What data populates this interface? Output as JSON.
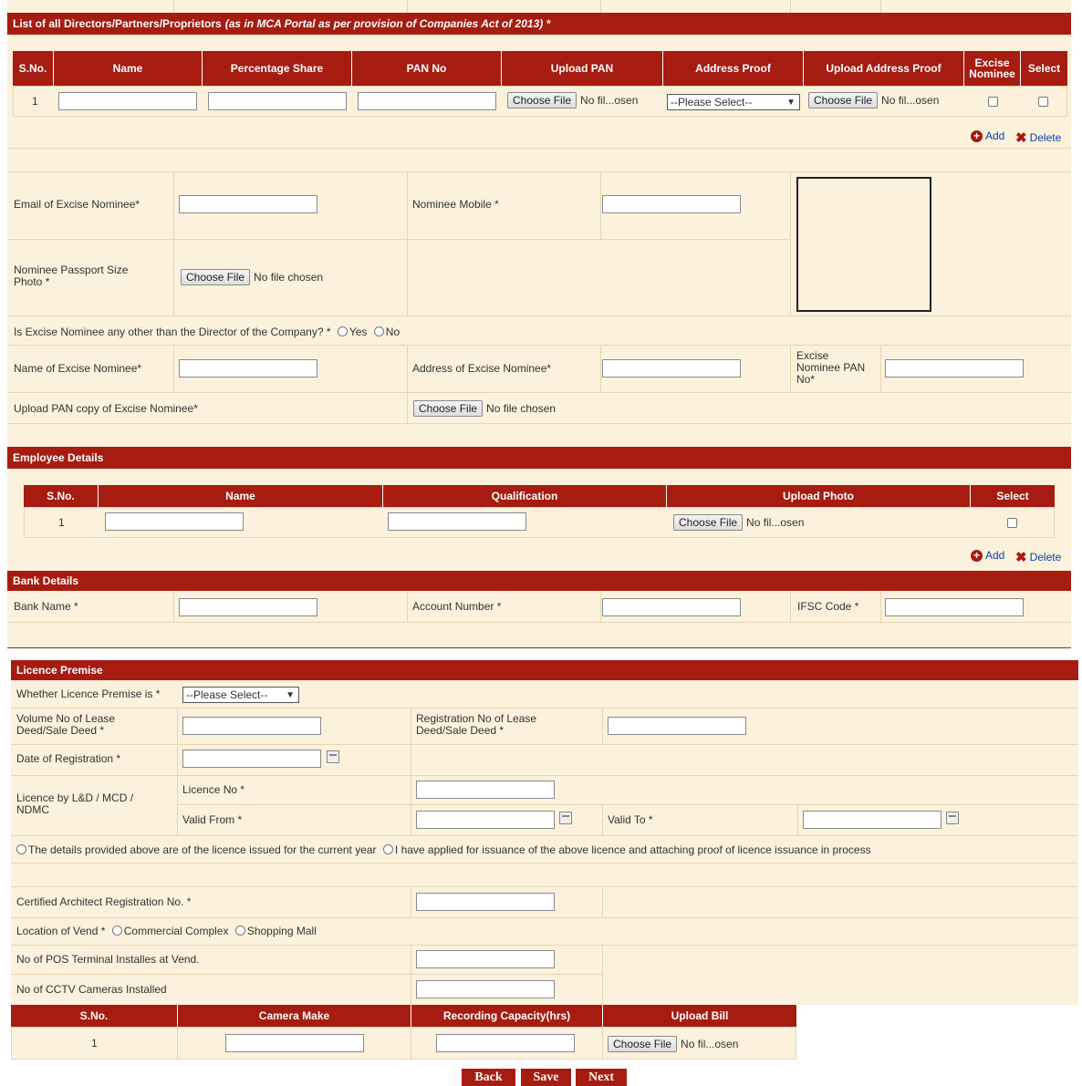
{
  "directors": {
    "title": "List of all Directors/Partners/Proprietors",
    "title_note": "(as in MCA Portal as per provision of Companies Act of 2013) *",
    "headers": [
      "S.No.",
      "Name",
      "Percentage Share",
      "PAN No",
      "Upload PAN",
      "Address Proof",
      "Upload Address Proof",
      "Excise Nominee",
      "Select"
    ],
    "row_sno": "1",
    "file_button": "Choose File",
    "file_status_short": "No fil...osen",
    "address_select": "--Please Select--",
    "add_label": "Add",
    "delete_label": "Delete"
  },
  "nominee": {
    "email_label": "Email of Excise Nominee*",
    "mobile_label": "Nominee Mobile *",
    "photo_label": "Nominee Passport Size Photo *",
    "file_button": "Choose File",
    "file_status": "No file chosen",
    "question": "Is Excise Nominee any other than the Director of the Company? *",
    "yes": "Yes",
    "no": "No",
    "name_label": "Name of Excise Nominee*",
    "address_label": "Address of Excise Nominee*",
    "pan_label": "Excise Nominee PAN No*",
    "upload_pan_label": "Upload PAN copy of Excise Nominee*"
  },
  "employee": {
    "title": "Employee Details",
    "headers": [
      "S.No.",
      "Name",
      "Qualification",
      "Upload Photo",
      "Select"
    ],
    "row_sno": "1",
    "file_button": "Choose File",
    "file_status_short": "No fil...osen",
    "add_label": "Add",
    "delete_label": "Delete"
  },
  "bank": {
    "title": "Bank Details",
    "bank_name_label": "Bank Name *",
    "account_label": "Account Number *",
    "ifsc_label": "IFSC Code *"
  },
  "licence": {
    "title": "Licence Premise",
    "premise_label": "Whether Licence Premise is *",
    "premise_select": "--Please Select--",
    "volume_label": "Volume No of Lease Deed/Sale Deed *",
    "registration_label": "Registration No of Lease Deed/Sale Deed *",
    "date_label": "Date of Registration *",
    "lnd_label": "Licence by L&D / MCD / NDMC",
    "licence_no_label": "Licence No *",
    "valid_from_label": "Valid From *",
    "valid_to_label": "Valid To *",
    "option_current": "The details provided above are of the licence issued for the current year",
    "option_applied": "I have applied for issuance of the above licence and attaching proof of licence issuance in process",
    "architect_label": "Certified Architect Registration No. *",
    "location_label": "Location of Vend *",
    "location_commercial": "Commercial Complex",
    "location_mall": "Shopping Mall",
    "pos_label": "No of POS Terminal Installes at Vend.",
    "cctv_label": "No of CCTV Cameras Installed",
    "camera_headers": [
      "S.No.",
      "Camera Make",
      "Recording Capacity(hrs)",
      "Upload Bill"
    ],
    "camera_row_sno": "1",
    "file_button": "Choose File",
    "file_status_short": "No fil...osen"
  },
  "nav": {
    "back": "Back",
    "save": "Save",
    "next": "Next"
  },
  "colors": {
    "header_red": "#a61c11",
    "panel_beige": "#fbf1dc",
    "link_blue": "#0645ad"
  }
}
